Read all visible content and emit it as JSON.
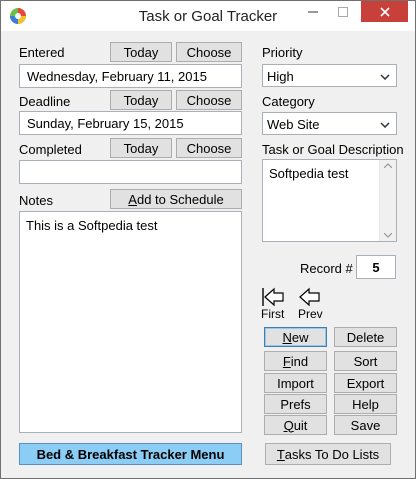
{
  "window": {
    "title": "Task or Goal Tracker"
  },
  "entered": {
    "label": "Entered",
    "today": "Today",
    "choose": "Choose",
    "value": "Wednesday, February 11, 2015"
  },
  "deadline": {
    "label": "Deadline",
    "today": "Today",
    "choose": "Choose",
    "value": "Sunday, February 15, 2015"
  },
  "completed": {
    "label": "Completed",
    "today": "Today",
    "choose": "Choose",
    "value": ""
  },
  "notes": {
    "label": "Notes",
    "add_schedule": "Add to Schedule",
    "value": "This is a Softpedia test"
  },
  "priority": {
    "label": "Priority",
    "value": "High"
  },
  "category": {
    "label": "Category",
    "value": "Web Site"
  },
  "description": {
    "label": "Task or Goal Description",
    "value": "Softpedia test"
  },
  "record": {
    "label": "Record #",
    "value": "5"
  },
  "nav": {
    "first": "First",
    "prev": "Prev"
  },
  "actions": {
    "new": "New",
    "delete": "Delete",
    "find": "Find",
    "sort": "Sort",
    "import": "Import",
    "export": "Export",
    "prefs": "Prefs",
    "help": "Help",
    "quit": "Quit",
    "save": "Save"
  },
  "footer": {
    "menu": "Bed & Breakfast Tracker Menu",
    "tasks": "Tasks To Do Lists"
  },
  "colors": {
    "menu_button": "#8ccdf5",
    "close_button": "#c7403a"
  }
}
